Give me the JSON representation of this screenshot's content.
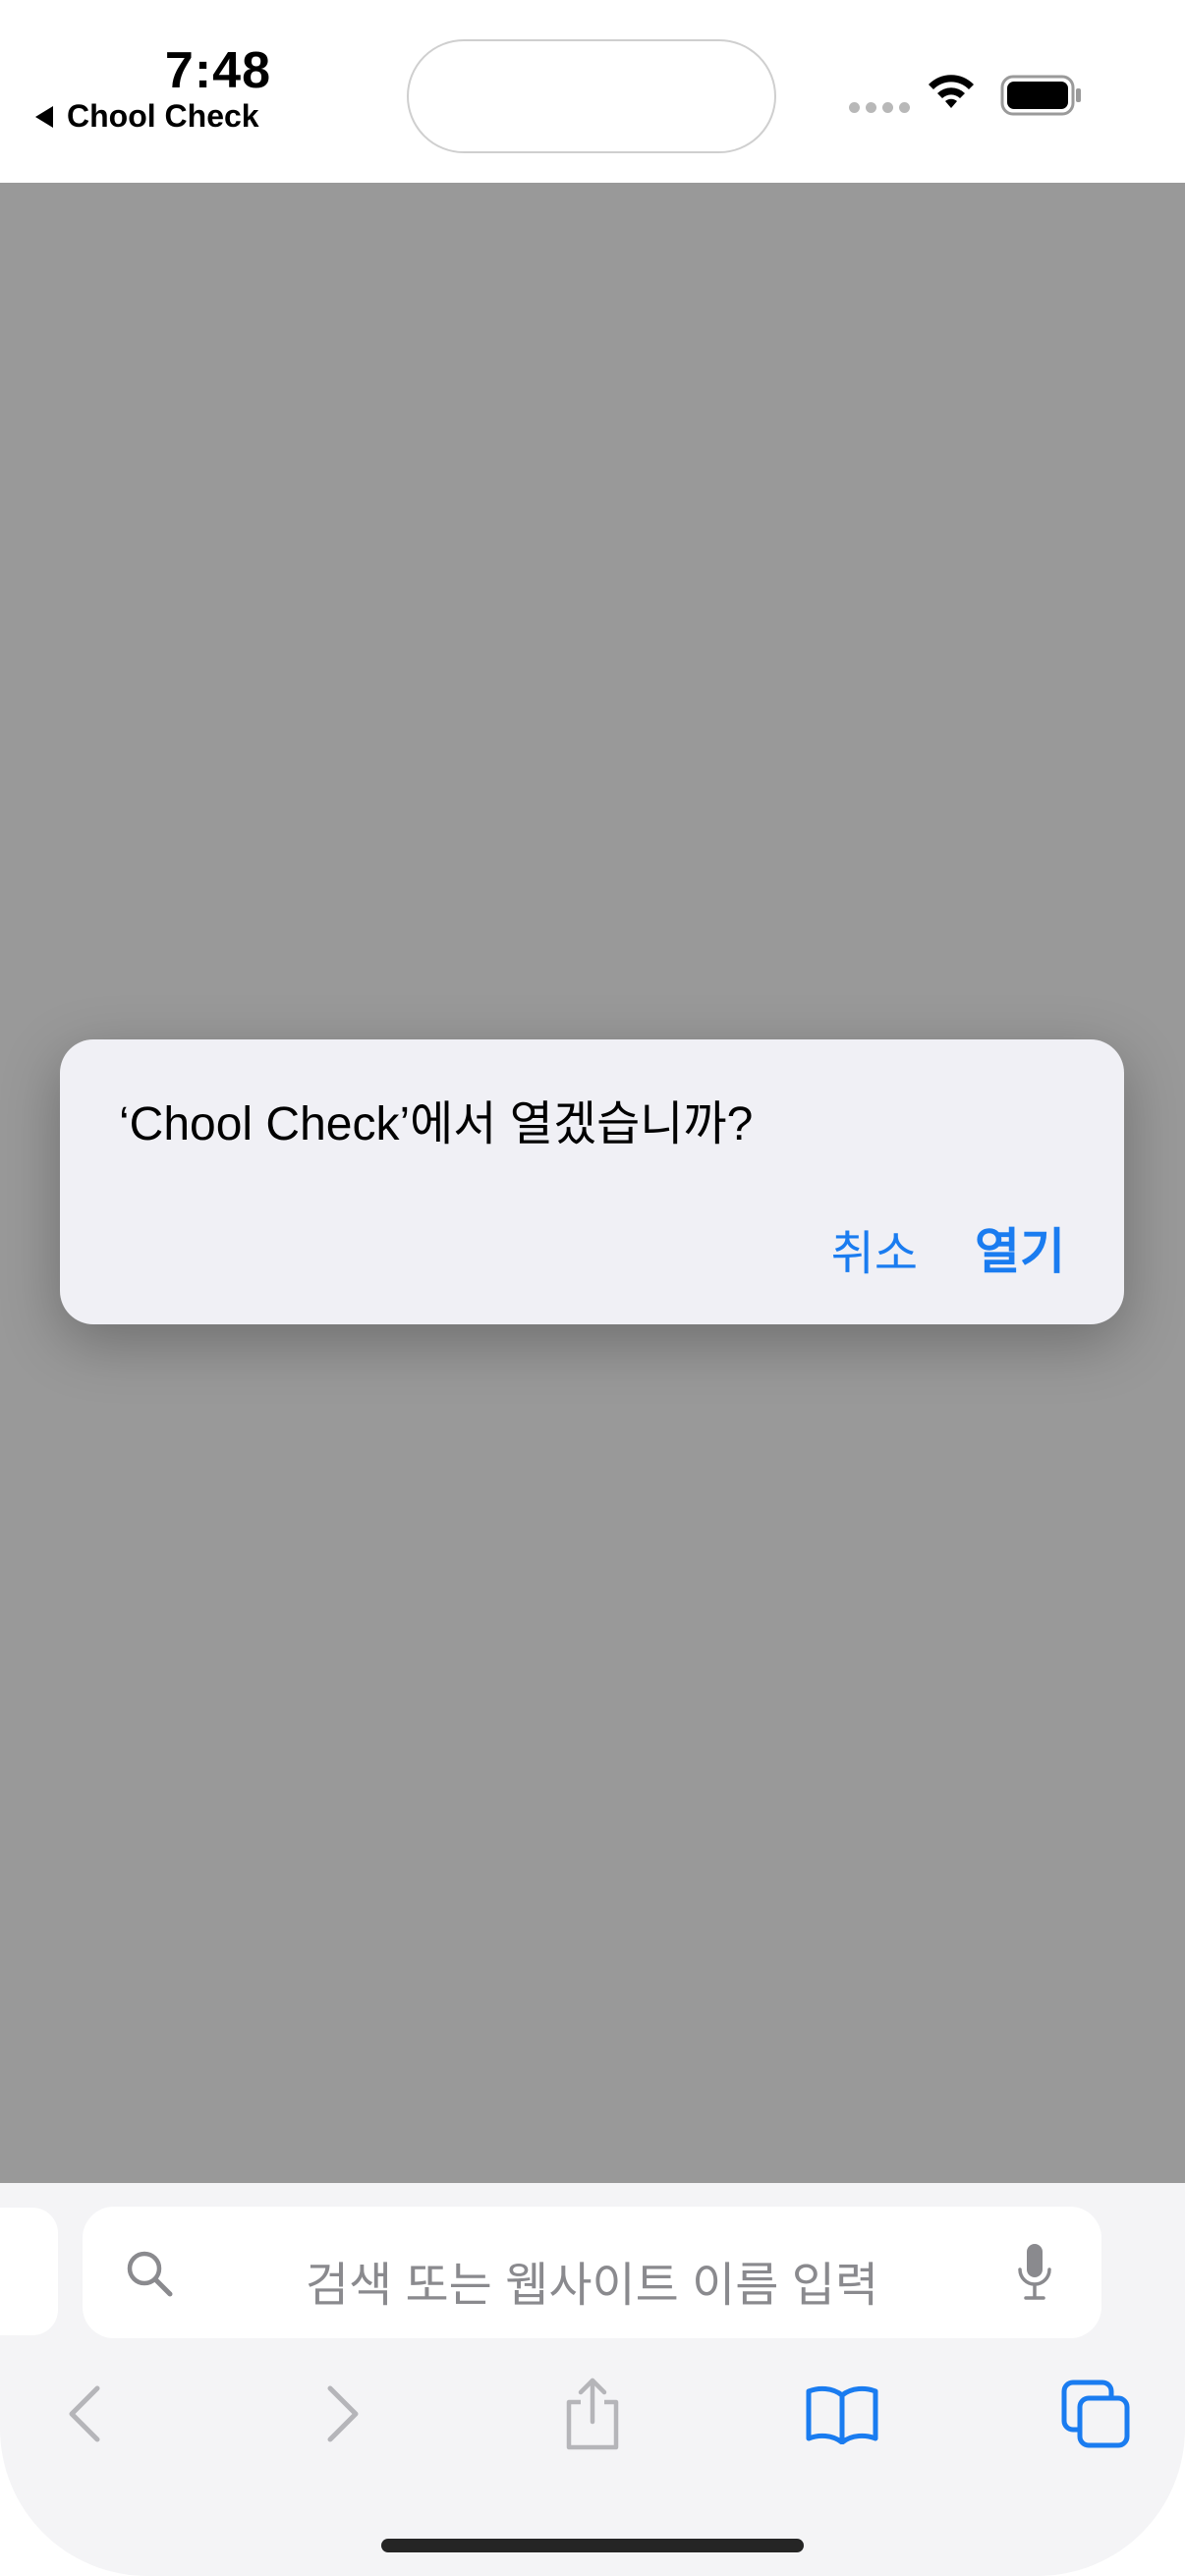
{
  "status_bar": {
    "time": "7:48",
    "back_app_label": "Chool Check",
    "wifi_icon": "wifi-icon",
    "battery_icon": "battery-icon"
  },
  "alert": {
    "message": "‘Chool Check’에서 열겠습니까?",
    "cancel_label": "취소",
    "open_label": "열기",
    "accent_color": "#1a7cf0"
  },
  "toolbar": {
    "address_placeholder": "검색 또는 웹사이트 이름 입력",
    "icons": [
      "search-icon",
      "mic-icon",
      "back-icon",
      "forward-icon",
      "share-icon",
      "bookmarks-icon",
      "tabs-icon"
    ]
  },
  "colors": {
    "dim_background": "#999999",
    "toolbar_background": "#f4f4f6",
    "disabled_icon": "#b5b5b9"
  }
}
